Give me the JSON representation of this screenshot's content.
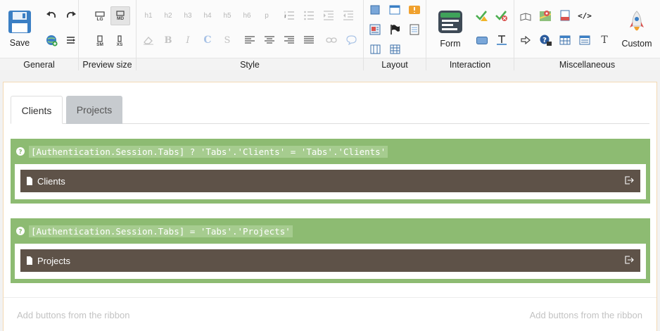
{
  "ribbon": {
    "general": {
      "label": "General",
      "save_label": "Save"
    },
    "preview_size": {
      "label": "Preview size",
      "lg": "LG",
      "md": "MD",
      "sm": "SM",
      "xs": "XS"
    },
    "style": {
      "label": "Style",
      "headings": [
        "h1",
        "h2",
        "h3",
        "h4",
        "h5",
        "h6",
        "p"
      ]
    },
    "layout": {
      "label": "Layout"
    },
    "interaction": {
      "label": "Interaction",
      "form_label": "Form"
    },
    "misc": {
      "label": "Miscellaneous",
      "text_glyph": "T",
      "custom_label": "Custom"
    }
  },
  "tabs": [
    {
      "label": "Clients",
      "active": true
    },
    {
      "label": "Projects",
      "active": false
    }
  ],
  "conditions": [
    {
      "expression": "[Authentication.Session.Tabs] ? 'Tabs'.'Clients' = 'Tabs'.'Clients'",
      "page_label": "Clients"
    },
    {
      "expression": "[Authentication.Session.Tabs] = 'Tabs'.'Projects'",
      "page_label": "Projects"
    }
  ],
  "footer": {
    "hint_left": "Add buttons from the ribbon",
    "hint_right": "Add buttons from the ribbon"
  },
  "colors": {
    "condition_bg": "#8dbb72",
    "page_bar": "#5e5248",
    "accent_blue": "#3b7fc4"
  }
}
